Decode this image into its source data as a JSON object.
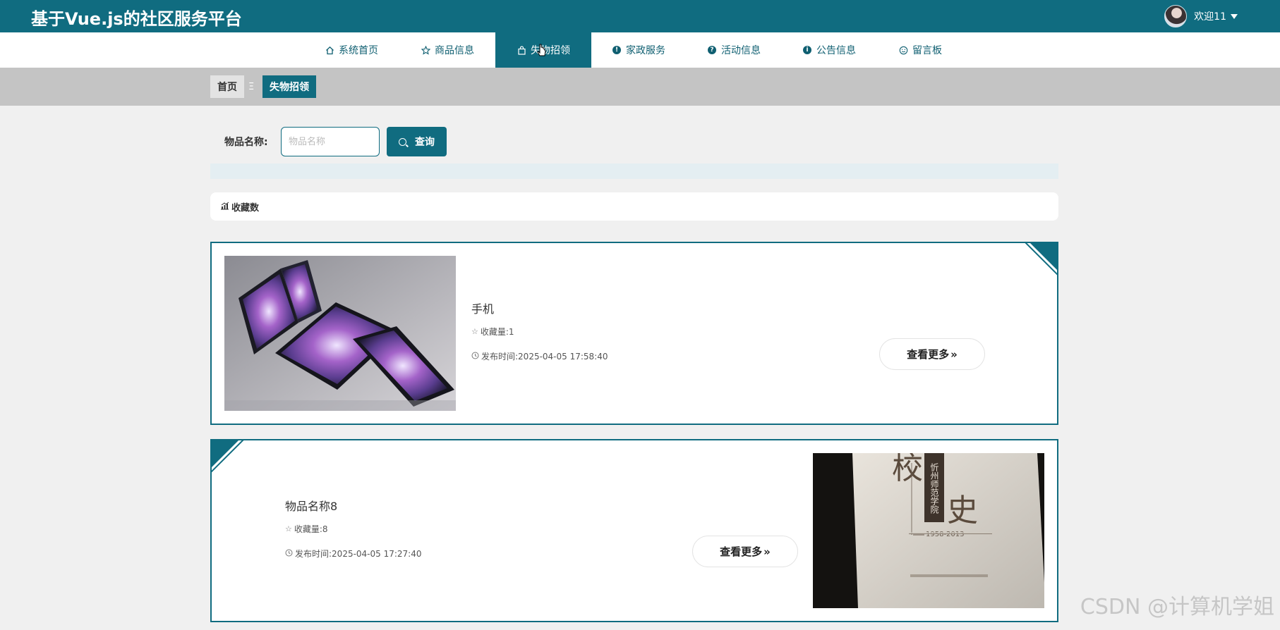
{
  "header": {
    "site_title": "基于Vue.js的社区服务平台",
    "welcome": "欢迎11"
  },
  "nav": {
    "items": [
      {
        "label": "系统首页",
        "icon": "home-icon"
      },
      {
        "label": "商品信息",
        "icon": "star-icon"
      },
      {
        "label": "失物招领",
        "icon": "bag-icon",
        "active": true
      },
      {
        "label": "家政服务",
        "icon": "exclamation-circle-icon"
      },
      {
        "label": "活动信息",
        "icon": "question-circle-icon"
      },
      {
        "label": "公告信息",
        "icon": "info-circle-icon"
      },
      {
        "label": "留言板",
        "icon": "smile-icon"
      }
    ]
  },
  "breadcrumb": {
    "home": "首页",
    "separator": "Ξ",
    "current": "失物招领"
  },
  "search": {
    "label": "物品名称:",
    "placeholder": "物品名称",
    "value": "",
    "button_label": "查询"
  },
  "sort": {
    "label": "收藏数"
  },
  "items": [
    {
      "title": "手机",
      "fav_label": "收藏量:",
      "fav_count": "1",
      "time_label": "发布时间:",
      "time": "2025-04-05 17:58:40",
      "more_label": "查看更多"
    },
    {
      "title": "物品名称8",
      "fav_label": "收藏量:",
      "fav_count": "8",
      "time_label": "发布时间:",
      "time": "2025-04-05 17:27:40",
      "more_label": "查看更多"
    }
  ],
  "book_cover": {
    "big_chars_1": "校",
    "big_chars_2": "史",
    "vertical_text": "忻州师范学院",
    "years": "1958-2013"
  },
  "watermark": "CSDN @计算机学姐",
  "colors": {
    "primary": "#106c80",
    "crumb_bg": "#c4c4c4",
    "page_bg": "#f0f0f0"
  }
}
